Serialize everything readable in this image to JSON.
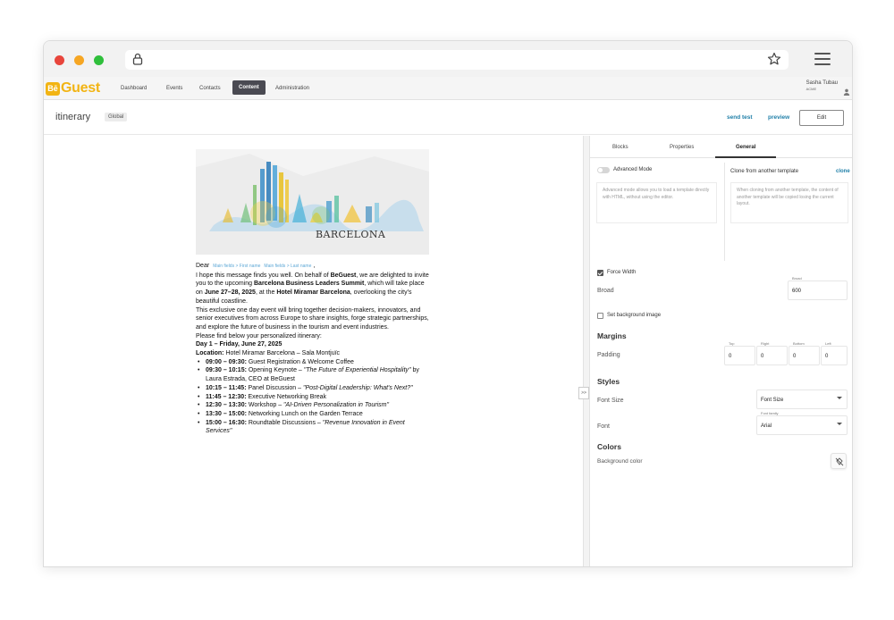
{
  "nav": {
    "logo_be": "Bē",
    "logo_text": "Guest",
    "items": [
      "Dashboard",
      "Events",
      "Contacts",
      "Content",
      "Administration"
    ],
    "user_name": "Sasha Tubau",
    "user_org": "ACME"
  },
  "header": {
    "title": "itinerary",
    "badge": "Global",
    "send_test": "send test",
    "preview": "preview",
    "edit": "Edit"
  },
  "email": {
    "hero_text": "BARCELONA",
    "dear": "Dear",
    "chip_first": "Main fields > First name",
    "chip_last": "Main fields > Last name",
    "comma": ",",
    "p1_a": "I hope this message finds you well. On behalf of ",
    "p1_b": "BeGuest",
    "p1_c": ", we are delighted to invite you to the upcoming ",
    "p1_d": "Barcelona Business Leaders Summit",
    "p1_e": ", which will take place on ",
    "p1_f": "June 27–28, 2025",
    "p1_g": ", at the ",
    "p1_h": "Hotel Miramar Barcelona",
    "p1_i": ", overlooking the city's beautiful coastline.",
    "p2": "This exclusive one day event will bring together decision-makers, innovators, and senior executives from across Europe to share insights, forge strategic partnerships, and explore the future of business in the tourism and event industries.",
    "p3": "Please find below your personalized itinerary:",
    "day": "Day 1 – Friday, June 27, 2025",
    "loc_label": "Location:",
    "loc_value": " Hotel Miramar Barcelona – Sala Montjuïc",
    "items": [
      {
        "time": "09:00 – 09:30:",
        "text": " Guest Registration & Welcome Coffee",
        "ital": ""
      },
      {
        "time": "09:30 – 10:15:",
        "text": " Opening Keynote – ",
        "ital": "\"The Future of Experiential Hospitality\"",
        "tail": " by Laura Estrada, CEO at BeGuest"
      },
      {
        "time": "10:15 – 11:45:",
        "text": " Panel Discussion – ",
        "ital": "\"Post-Digital Leadership: What's Next?\""
      },
      {
        "time": "11:45 – 12:30:",
        "text": " Executive Networking Break",
        "ital": ""
      },
      {
        "time": "12:30 – 13:30:",
        "text": " Workshop – ",
        "ital": "\"AI-Driven Personalization in Tourism\""
      },
      {
        "time": "13:30 – 15:00:",
        "text": " Networking Lunch on the Garden Terrace",
        "ital": ""
      },
      {
        "time": "15:00 – 16:30:",
        "text": " Roundtable Discussions – ",
        "ital": "\"Revenue Innovation in Event Services\""
      }
    ]
  },
  "panel": {
    "tabs": [
      "Blocks",
      "Properties",
      "General"
    ],
    "advanced_mode": "Advanced Mode",
    "advanced_help": "Advanced mode allows you to load a template directly with HTML, without using the editor.",
    "clone_label": "Clone from another template",
    "clone_link": "clone",
    "clone_help": "When cloning from another template, the content of another template will be copied losing the current layout.",
    "force_width": "Force Width",
    "broad_label": "Broad",
    "broad_cap": "Broad",
    "broad_value": "600",
    "set_bg_image": "Set background image",
    "margins_heading": "Margins",
    "padding_label": "Padding",
    "padding": [
      {
        "cap": "Top",
        "value": "0"
      },
      {
        "cap": "Right",
        "value": "0"
      },
      {
        "cap": "Bottom",
        "value": "0"
      },
      {
        "cap": "Left",
        "value": "0"
      }
    ],
    "styles_heading": "Styles",
    "font_size_label": "Font Size",
    "font_size_value": "Font Size",
    "font_label": "Font",
    "font_cap": "Font family",
    "font_value": "Arial",
    "colors_heading": "Colors",
    "bg_color_label": "Background color"
  },
  "collapse_handle": ">>"
}
